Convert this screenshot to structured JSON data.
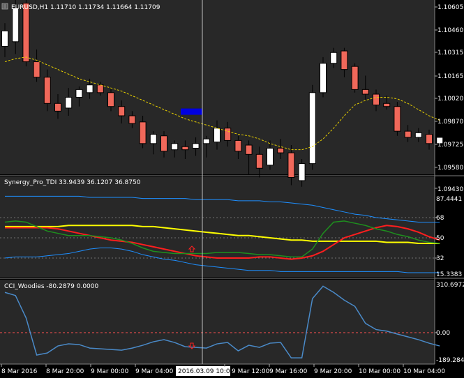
{
  "colors": {
    "background": "#000000",
    "panel_bg": "#282828",
    "grid": "#606060",
    "text": "#ffffff",
    "bull_body": "#ffffff",
    "bear_body": "#f0685a",
    "candle_outline": "#000000",
    "ma": "#e8d000",
    "tdi_band": "#1e8fff",
    "tdi_yellow": "#ffff00",
    "tdi_red": "#ff1e1e",
    "tdi_green": "#1e8f1e",
    "cci_line": "#4a8ac8",
    "cci_zero": "#ff5050",
    "marker_rect": "#0000e0",
    "arrow": "#ff2020",
    "time_label_bg": "#ffffff",
    "time_label_text": "#000000"
  },
  "main_panel": {
    "title": "EURUSD,H1  1.11710 1.11734 1.11664 1.11709",
    "price_axis": [
      "1.10605",
      "1.10460",
      "1.10315",
      "1.10165",
      "1.10020",
      "1.09870",
      "1.09725",
      "1.09580",
      "1.09430"
    ]
  },
  "tdi_panel": {
    "title": "Synergy_Pro_TDI 33.9439 36.1207 36.8750",
    "axis": [
      "87.4441",
      "68",
      "50",
      "32",
      "15.3383"
    ]
  },
  "cci_panel": {
    "title": "CCI_Woodies -80.2879 0.0000",
    "axis": [
      "310.6972",
      "0.00",
      "-189.2845"
    ]
  },
  "time_axis": [
    "8 Mar 2016",
    "8 Mar 20:00",
    "9 Mar 00:00",
    "9 Mar 04:00",
    "2016.03.09 10:00",
    "9 Mar 12:00",
    "9 Mar 16:00",
    "9 Mar 20:00",
    "10 Mar 00:00",
    "10 Mar 04:00"
  ],
  "chart_data": [
    {
      "type": "candlestick",
      "title": "EURUSD,H1",
      "ohlc_header": {
        "open": 1.1171,
        "high": 1.11734,
        "low": 1.11664,
        "close": 1.11709
      },
      "ylim": [
        1.0941,
        1.1066
      ],
      "candles": [
        {
          "o": 1.1035,
          "h": 1.105,
          "l": 1.1028,
          "c": 1.1045
        },
        {
          "o": 1.1038,
          "h": 1.1065,
          "l": 1.103,
          "c": 1.106
        },
        {
          "o": 1.1063,
          "h": 1.1066,
          "l": 1.1022,
          "c": 1.1025
        },
        {
          "o": 1.1025,
          "h": 1.1033,
          "l": 1.1012,
          "c": 1.1015
        },
        {
          "o": 1.1015,
          "h": 1.102,
          "l": 1.0993,
          "c": 1.0998
        },
        {
          "o": 1.0998,
          "h": 1.1004,
          "l": 1.0988,
          "c": 1.0993
        },
        {
          "o": 1.0995,
          "h": 1.1008,
          "l": 1.099,
          "c": 1.1002
        },
        {
          "o": 1.1002,
          "h": 1.1009,
          "l": 1.0996,
          "c": 1.1007
        },
        {
          "o": 1.1005,
          "h": 1.1014,
          "l": 1.1001,
          "c": 1.101
        },
        {
          "o": 1.101,
          "h": 1.1012,
          "l": 1.1003,
          "c": 1.1005
        },
        {
          "o": 1.1005,
          "h": 1.1008,
          "l": 1.0993,
          "c": 1.0996
        },
        {
          "o": 1.0996,
          "h": 1.1,
          "l": 1.0985,
          "c": 1.099
        },
        {
          "o": 1.099,
          "h": 1.0993,
          "l": 1.0982,
          "c": 1.0985
        },
        {
          "o": 1.0986,
          "h": 1.099,
          "l": 1.0969,
          "c": 1.0972
        },
        {
          "o": 1.0972,
          "h": 1.098,
          "l": 1.0965,
          "c": 1.0978
        },
        {
          "o": 1.0977,
          "h": 1.098,
          "l": 1.0963,
          "c": 1.0967
        },
        {
          "o": 1.0968,
          "h": 1.0974,
          "l": 1.0963,
          "c": 1.0972
        },
        {
          "o": 1.097,
          "h": 1.0974,
          "l": 1.0962,
          "c": 1.0968
        },
        {
          "o": 1.0969,
          "h": 1.0976,
          "l": 1.0964,
          "c": 1.0972
        },
        {
          "o": 1.0972,
          "h": 1.0977,
          "l": 1.0963,
          "c": 1.0975
        },
        {
          "o": 1.0973,
          "h": 1.0987,
          "l": 1.0968,
          "c": 1.0982
        },
        {
          "o": 1.0982,
          "h": 1.0986,
          "l": 1.097,
          "c": 1.0974
        },
        {
          "o": 1.0974,
          "h": 1.0977,
          "l": 1.0962,
          "c": 1.0967
        },
        {
          "o": 1.0971,
          "h": 1.0974,
          "l": 1.0952,
          "c": 1.0965
        },
        {
          "o": 1.0965,
          "h": 1.097,
          "l": 1.095,
          "c": 1.0956
        },
        {
          "o": 1.0958,
          "h": 1.0974,
          "l": 1.0955,
          "c": 1.0969
        },
        {
          "o": 1.0969,
          "h": 1.0975,
          "l": 1.0962,
          "c": 1.0966
        },
        {
          "o": 1.0966,
          "h": 1.0971,
          "l": 1.0945,
          "c": 1.095
        },
        {
          "o": 1.0948,
          "h": 1.0962,
          "l": 1.0944,
          "c": 1.0959
        },
        {
          "o": 1.0959,
          "h": 1.101,
          "l": 1.0955,
          "c": 1.1005
        },
        {
          "o": 1.1005,
          "h": 1.1028,
          "l": 1.1002,
          "c": 1.1024
        },
        {
          "o": 1.1024,
          "h": 1.1034,
          "l": 1.1021,
          "c": 1.1031
        },
        {
          "o": 1.1032,
          "h": 1.1034,
          "l": 1.1015,
          "c": 1.102
        },
        {
          "o": 1.1022,
          "h": 1.1024,
          "l": 1.1005,
          "c": 1.1007
        },
        {
          "o": 1.1007,
          "h": 1.1016,
          "l": 1.1,
          "c": 1.1004
        },
        {
          "o": 1.1004,
          "h": 1.1007,
          "l": 1.0993,
          "c": 1.0997
        },
        {
          "o": 1.0998,
          "h": 1.1003,
          "l": 1.0994,
          "c": 1.0996
        },
        {
          "o": 1.0996,
          "h": 1.0999,
          "l": 1.0977,
          "c": 1.098
        },
        {
          "o": 1.098,
          "h": 1.0984,
          "l": 1.0973,
          "c": 1.0976
        },
        {
          "o": 1.0976,
          "h": 1.0982,
          "l": 1.0973,
          "c": 1.0979
        },
        {
          "o": 1.0978,
          "h": 1.0981,
          "l": 1.0968,
          "c": 1.0972
        },
        {
          "o": 1.0972,
          "h": 1.0977,
          "l": 1.0969,
          "c": 1.0976
        }
      ],
      "ma": [
        1.1025,
        1.1027,
        1.1028,
        1.1026,
        1.1023,
        1.102,
        1.1017,
        1.1014,
        1.1012,
        1.101,
        1.1008,
        1.1006,
        1.1003,
        1.1,
        1.0997,
        1.0994,
        1.0991,
        1.0988,
        1.0986,
        1.0984,
        1.0982,
        1.098,
        1.0978,
        1.0977,
        1.0975,
        1.0972,
        1.097,
        1.0968,
        1.0968,
        1.097,
        1.0975,
        1.0982,
        1.099,
        1.0997,
        1.1,
        1.1002,
        1.1002,
        1.1001,
        1.0998,
        1.0994,
        1.099,
        1.0987
      ],
      "marker_price": 1.0992
    },
    {
      "type": "line",
      "title": "Synergy_Pro_TDI",
      "ylim": [
        15.3383,
        87.4441
      ],
      "levels": [
        68,
        50,
        32
      ],
      "series": [
        {
          "name": "upper",
          "values": [
            87,
            87,
            87,
            87,
            87,
            87,
            87,
            87,
            86,
            86,
            86,
            86,
            86,
            85,
            85,
            85,
            85,
            85,
            84,
            84,
            84,
            84,
            83,
            83,
            83,
            82,
            82,
            81,
            80,
            79,
            77,
            75,
            73,
            71,
            70,
            68,
            67,
            66,
            65,
            64,
            64,
            64
          ]
        },
        {
          "name": "lower",
          "values": [
            32,
            33,
            33,
            33,
            34,
            35,
            36,
            38,
            40,
            41,
            41,
            40,
            38,
            35,
            33,
            31,
            30,
            28,
            26,
            25,
            24,
            23,
            22,
            21,
            21,
            21,
            20,
            20,
            20,
            20,
            20,
            20,
            20,
            20,
            20,
            20,
            20,
            20,
            19,
            19,
            19,
            19
          ]
        },
        {
          "name": "yellow",
          "values": [
            60,
            60,
            60,
            60,
            60,
            60,
            61,
            61,
            61,
            61,
            61,
            61,
            61,
            60,
            60,
            59,
            58,
            57,
            56,
            55,
            54,
            53,
            52,
            52,
            51,
            50,
            49,
            48,
            48,
            47,
            47,
            47,
            47,
            47,
            47,
            47,
            46,
            46,
            46,
            45,
            45,
            45
          ]
        },
        {
          "name": "red",
          "values": [
            59,
            59,
            59,
            59,
            59,
            58,
            56,
            54,
            52,
            50,
            48,
            47,
            46,
            44,
            42,
            40,
            38,
            36,
            34,
            33,
            32,
            32,
            32,
            32,
            33,
            33,
            32,
            31,
            32,
            34,
            38,
            44,
            50,
            53,
            56,
            59,
            61,
            60,
            58,
            55,
            51,
            48
          ]
        },
        {
          "name": "green",
          "values": [
            64,
            65,
            64,
            60,
            56,
            54,
            52,
            52,
            52,
            51,
            50,
            48,
            45,
            41,
            38,
            37,
            36,
            36,
            36,
            36,
            37,
            37,
            37,
            36,
            35,
            35,
            34,
            33,
            33,
            40,
            54,
            64,
            65,
            63,
            61,
            58,
            56,
            53,
            51,
            48,
            46,
            45
          ]
        }
      ]
    },
    {
      "type": "line",
      "title": "CCI_Woodies",
      "ylim": [
        -189.2845,
        310.6972
      ],
      "series": [
        {
          "name": "cci",
          "values": [
            260,
            240,
            95,
            -160,
            -145,
            -95,
            -80,
            -85,
            -110,
            -115,
            -120,
            -125,
            -110,
            -90,
            -65,
            -50,
            -70,
            -100,
            -105,
            -110,
            -80,
            -70,
            -130,
            -90,
            -105,
            -75,
            -70,
            -180,
            -180,
            220,
            300,
            260,
            210,
            170,
            60,
            20,
            10,
            -10,
            -30,
            -50,
            -75,
            -95
          ]
        }
      ]
    }
  ]
}
